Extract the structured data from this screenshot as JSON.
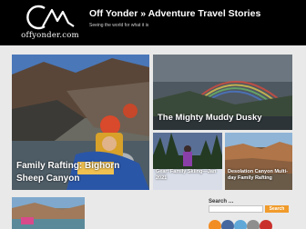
{
  "site": {
    "title": "Off Yonder » Adventure Travel Stories",
    "tagline": "Seeing the world for what it is",
    "logo_text": "offyonder.com"
  },
  "featured": [
    {
      "title": "Family Rafting: Bighorn Sheep Canyon"
    },
    {
      "title": "The Mighty Muddy Dusky"
    },
    {
      "title": "Gear: Family Skiing—Jan 2021"
    },
    {
      "title": "Desolation Canyon Multi-day Family Rafting"
    }
  ],
  "sidebar": {
    "search_label": "Search …",
    "search_placeholder": "",
    "search_button": "Search",
    "social_icons": [
      "rss-icon",
      "facebook-icon",
      "twitter-icon",
      "instagram-icon",
      "youtube-icon"
    ]
  },
  "colors": {
    "header_bg": "#000000",
    "page_bg": "#e9e9e9",
    "accent": "#f09b2b"
  }
}
